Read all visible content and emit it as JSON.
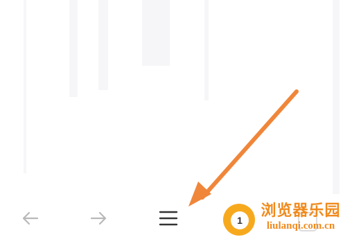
{
  "toolbar": {
    "back_icon": "arrow-left-icon",
    "forward_icon": "arrow-right-icon",
    "menu_icon": "hamburger-menu-icon",
    "tabs_count": "1",
    "tabs_icon": "tabs-icon"
  },
  "annotation": {
    "arrow_color": "#f0863a"
  },
  "watermark": {
    "chinese": "浏览器乐园",
    "domain": "liulanqi.com.cn",
    "color": "#f08a1c"
  },
  "colors": {
    "toolbar_icon_disabled": "#b8b8b8",
    "toolbar_icon_active": "#333333"
  }
}
